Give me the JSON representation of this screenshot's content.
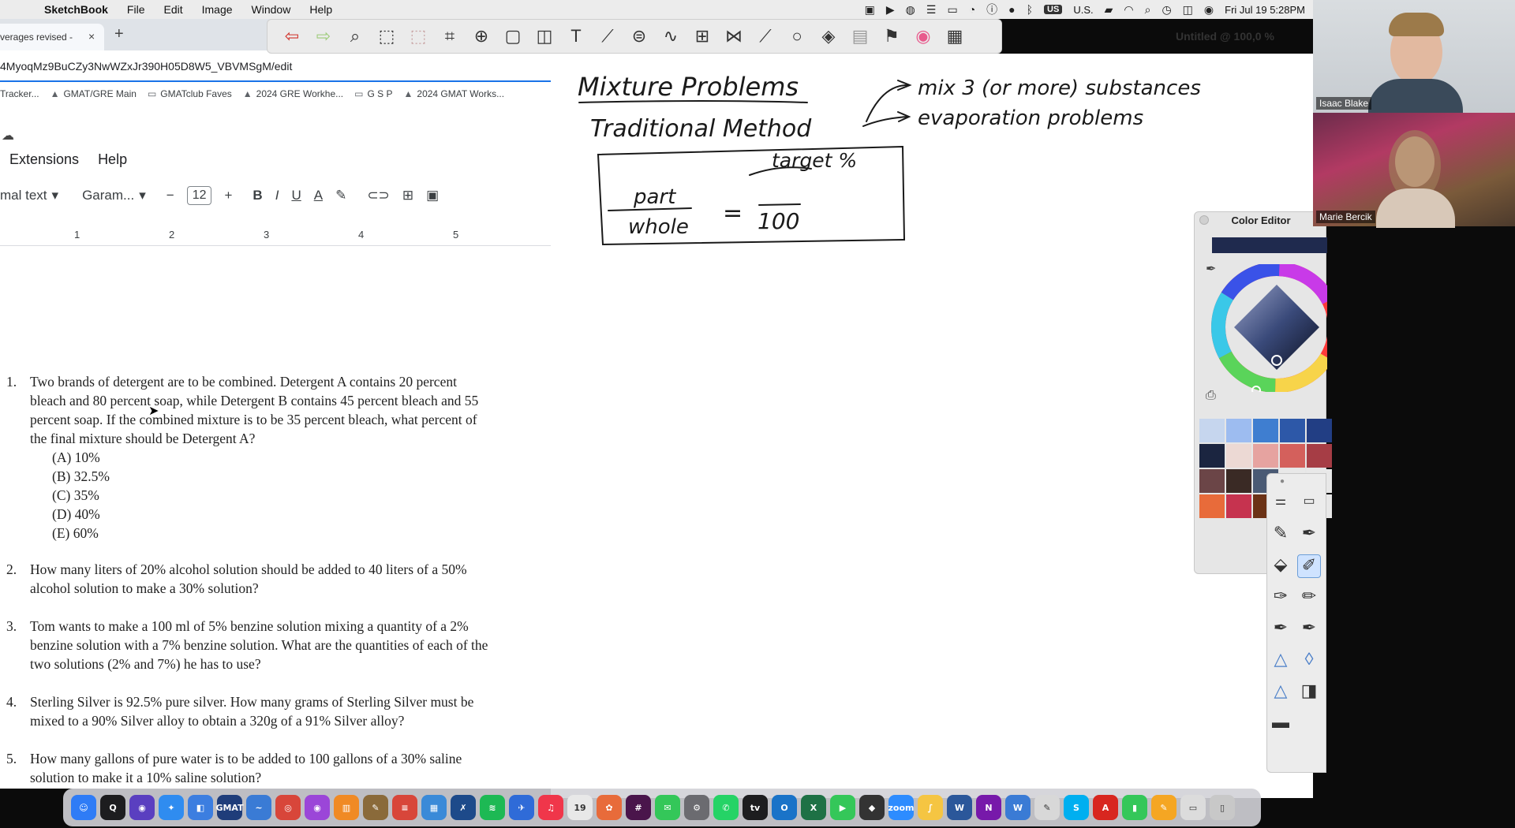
{
  "menubar": {
    "app_name": "SketchBook",
    "items": [
      "File",
      "Edit",
      "Image",
      "Window",
      "Help"
    ],
    "input_source": "US",
    "input_label": "U.S.",
    "clock": "Fri Jul 19  5:28PM"
  },
  "browser": {
    "tab_title": "verages revised -",
    "tab_close": "×",
    "new_tab": "+",
    "url": "4MyoqMz9BuCZy3NwWZxJr390H05D8W5_VBVMSgM/edit",
    "bookmarks": [
      "Tracker...",
      "GMAT/GRE Main",
      "GMATclub Faves",
      "2024 GRE Workhe...",
      "G S P",
      "2024 GMAT Works..."
    ]
  },
  "docs": {
    "menu": [
      "Extensions",
      "Help"
    ],
    "style_select": "mal text",
    "font_select": "Garam...",
    "font_size": "12",
    "ruler_marks": [
      "1",
      "2",
      "3",
      "4",
      "5"
    ],
    "questions": [
      {
        "num": "1.",
        "lines": [
          "Two brands of detergent are to be combined. Detergent A contains 20 percent",
          "bleach and 80 percent soap, while Detergent B contains 45 percent bleach and 55",
          "percent soap. If the combined mixture is to be 35 percent bleach, what percent of",
          "the final mixture should be Detergent A?"
        ],
        "options": [
          "(A) 10%",
          "(B) 32.5%",
          "(C) 35%",
          "(D) 40%",
          "(E) 60%"
        ]
      },
      {
        "num": "2.",
        "lines": [
          "How many liters of 20% alcohol solution should be added to 40 liters of a 50%",
          "alcohol solution to make a 30% solution?"
        ]
      },
      {
        "num": "3.",
        "lines": [
          "Tom wants to make a 100 ml of 5% benzine solution mixing a quantity of a 2%",
          "benzine solution with a 7% benzine solution. What are the quantities of each of the",
          "two solutions (2% and 7%) he has to use?"
        ]
      },
      {
        "num": "4.",
        "lines": [
          "Sterling Silver is 92.5% pure silver. How many grams of Sterling Silver must be",
          "mixed to a 90% Silver alloy to obtain a 320g of a 91% Silver alloy?"
        ]
      },
      {
        "num": "5.",
        "lines": [
          "How many gallons of pure water is to be added to 100 gallons of a 30% saline",
          "solution to make it a 10% saline solution?"
        ]
      }
    ]
  },
  "sketchbook": {
    "title": "Untitled @ 100,0 %",
    "canvas_notes": {
      "heading": "Mixture Problems",
      "method": "Traditional Method",
      "branch1": "mix 3 (or more) substances",
      "branch2": "evaporation problems",
      "target": "target %",
      "numerator": "part",
      "denominator": "whole",
      "equals": "=",
      "hundred": "100"
    },
    "color_editor": {
      "title": "Color Editor",
      "current_color": "#1f2a4e",
      "swatches": [
        "#c6d6ee",
        "#9dbcf0",
        "#3f7ed0",
        "#2d58a8",
        "#223e84",
        "#1b2540",
        "#ecd9d4",
        "#e6a3a0",
        "#d4605c",
        "#a63d45",
        "#6b4547",
        "#3a2a25",
        "#4a5a74",
        "#e8e8e8",
        "#e8e8e8",
        "#e86b3a",
        "#c6334f",
        "#6b3216",
        "#e8e8e8",
        "#e8e8e8"
      ]
    }
  },
  "video": {
    "participant1": "Isaac Blake",
    "participant2": "Marie Bercik"
  },
  "dock": [
    {
      "name": "finder",
      "label": "☺",
      "color": "#2f7cf6"
    },
    {
      "name": "quicktime",
      "label": "Q",
      "color": "#1d1d1f"
    },
    {
      "name": "siri",
      "label": "◉",
      "color": "#5a3fc0"
    },
    {
      "name": "safari",
      "label": "✦",
      "color": "#2f8cf0"
    },
    {
      "name": "finder2",
      "label": "◧",
      "color": "#3c7ee0"
    },
    {
      "name": "gmat-prep",
      "label": "GMAT",
      "color": "#1f3d7a"
    },
    {
      "name": "freeform",
      "label": "~",
      "color": "#3a7bd5"
    },
    {
      "name": "chrome",
      "label": "◎",
      "color": "#d8463a"
    },
    {
      "name": "podcasts",
      "label": "◉",
      "color": "#9b46d8"
    },
    {
      "name": "books",
      "label": "▥",
      "color": "#f08a24"
    },
    {
      "name": "pencil",
      "label": "✎",
      "color": "#8a6a3a"
    },
    {
      "name": "scrivener",
      "label": "≡",
      "color": "#d8463a"
    },
    {
      "name": "grid",
      "label": "▦",
      "color": "#3a8ad8"
    },
    {
      "name": "sketchbook",
      "label": "✗",
      "color": "#1d4a8a"
    },
    {
      "name": "spotify",
      "label": "≋",
      "color": "#1db954"
    },
    {
      "name": "xcode",
      "label": "✈",
      "color": "#2f6bd8"
    },
    {
      "name": "music",
      "label": "♫",
      "color": "#f0364a"
    },
    {
      "name": "calendar",
      "label": "19",
      "color": "#e8e8e8"
    },
    {
      "name": "photos",
      "label": "✿",
      "color": "#e86b3a"
    },
    {
      "name": "slack",
      "label": "#",
      "color": "#4a154b"
    },
    {
      "name": "messages",
      "label": "✉",
      "color": "#34c759"
    },
    {
      "name": "settings",
      "label": "⚙",
      "color": "#6b6b70"
    },
    {
      "name": "whatsapp",
      "label": "✆",
      "color": "#25d366"
    },
    {
      "name": "appletv",
      "label": "tv",
      "color": "#1d1d1f"
    },
    {
      "name": "outlook",
      "label": "O",
      "color": "#1a73c8"
    },
    {
      "name": "excel",
      "label": "X",
      "color": "#1e7145"
    },
    {
      "name": "facetime",
      "label": "▶",
      "color": "#34c759"
    },
    {
      "name": "shortcuts",
      "label": "◆",
      "color": "#333333"
    },
    {
      "name": "zoom",
      "label": "zoom",
      "color": "#2d8cff"
    },
    {
      "name": "notes",
      "label": "∫",
      "color": "#f5c542"
    },
    {
      "name": "word",
      "label": "W",
      "color": "#2b579a"
    },
    {
      "name": "onenote",
      "label": "N",
      "color": "#7719aa"
    },
    {
      "name": "writer",
      "label": "W",
      "color": "#3a7bd5"
    },
    {
      "name": "textedit",
      "label": "✎",
      "color": "#d8d8d8"
    },
    {
      "name": "skype",
      "label": "S",
      "color": "#00aff0"
    },
    {
      "name": "acrobat",
      "label": "A",
      "color": "#d8261f"
    },
    {
      "name": "numbers",
      "label": "▮",
      "color": "#34c759"
    },
    {
      "name": "pages",
      "label": "✎",
      "color": "#f5a623"
    },
    {
      "name": "downloads",
      "label": "▭",
      "color": "#dcdcdc"
    },
    {
      "name": "trash",
      "label": "▯",
      "color": "#c8c8c8"
    }
  ]
}
